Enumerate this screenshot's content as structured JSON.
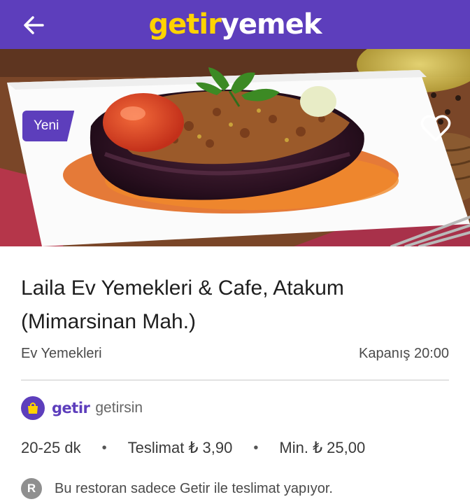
{
  "header": {
    "logo_getir": "getir",
    "logo_yemek": "yemek",
    "back_icon": "arrow-left-icon",
    "brand_color": "#5d3ebc",
    "accent_color": "#ffd300"
  },
  "hero": {
    "badge": "Yeni",
    "favorite_icon": "heart-outline-icon"
  },
  "restaurant": {
    "name": "Laila Ev Yemekleri & Cafe, Atakum (Mimarsinan Mah.)",
    "cuisine": "Ev Yemekleri",
    "closing": "Kapanış 20:00"
  },
  "delivery": {
    "brand": "getir",
    "label": "getirsin",
    "icon": "shopping-bag-icon"
  },
  "info": {
    "time": "20-25 dk",
    "fee": "Teslimat ₺ 3,90",
    "min": "Min. ₺ 25,00",
    "separator": "•"
  },
  "note": {
    "badge": "R",
    "text": "Bu restoran sadece Getir ile teslimat yapıyor."
  }
}
